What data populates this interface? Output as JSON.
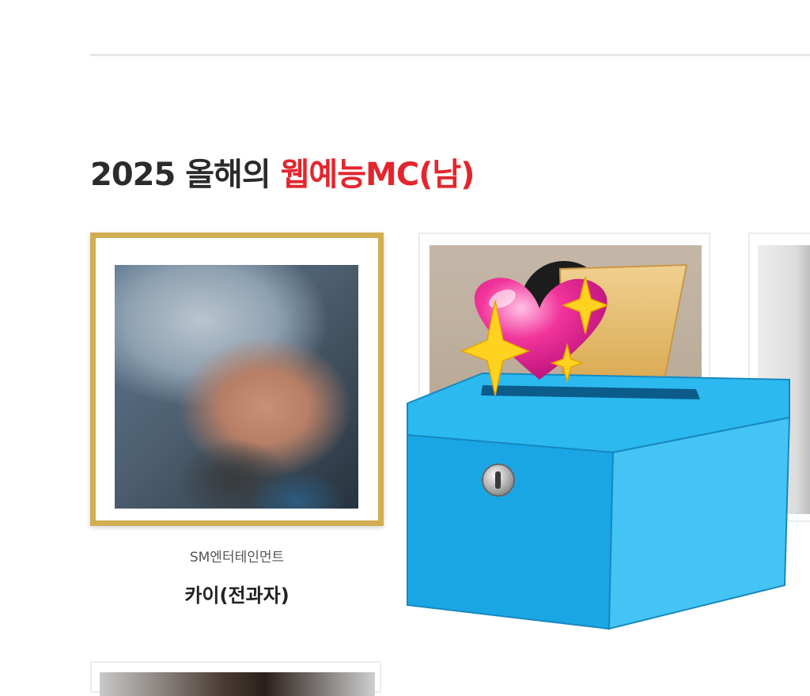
{
  "section": {
    "title_prefix": "2025 올해의 ",
    "title_accent": "웹예능MC(남)"
  },
  "candidates": [
    {
      "agency": "SM엔터테인먼트",
      "name": "카이(전과자)",
      "selected": true
    }
  ],
  "overlay": {
    "icon": "ballot-box-with-heart",
    "box_color": "#22b0e8",
    "heart_color": "#f2349a",
    "paper_color": "#e8c070"
  },
  "colors": {
    "accent": "#e3262e",
    "selected_border": "#d2ae53"
  }
}
